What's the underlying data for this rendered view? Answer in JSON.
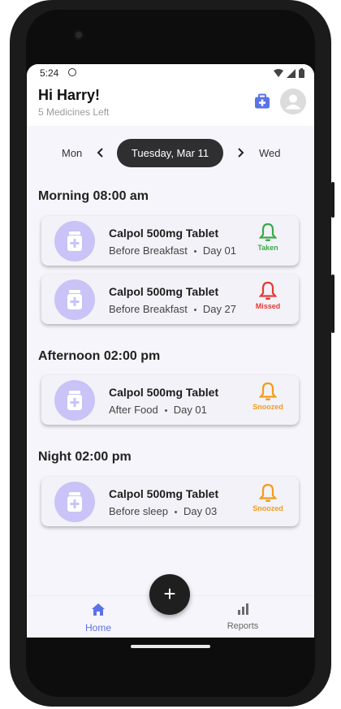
{
  "status_bar": {
    "time": "5:24"
  },
  "header": {
    "greeting": "Hi Harry!",
    "subtitle": "5 Medicines Left"
  },
  "date_strip": {
    "prev_day": "Mon",
    "selected_date": "Tuesday, Mar 11",
    "next_day": "Wed"
  },
  "sections": [
    {
      "title": "Morning 08:00 am",
      "cards": [
        {
          "name": "Calpol 500mg Tablet",
          "timing": "Before Breakfast",
          "day": "Day 01",
          "status": "Taken",
          "status_color": "#3aaa4a"
        },
        {
          "name": "Calpol 500mg Tablet",
          "timing": "Before Breakfast",
          "day": "Day 27",
          "status": "Missed",
          "status_color": "#e53935"
        }
      ]
    },
    {
      "title": "Afternoon 02:00 pm",
      "cards": [
        {
          "name": "Calpol 500mg Tablet",
          "timing": "After Food",
          "day": "Day 01",
          "status": "Snoozed",
          "status_color": "#f59b1a"
        }
      ]
    },
    {
      "title": "Night 02:00 pm",
      "cards": [
        {
          "name": "Calpol 500mg Tablet",
          "timing": "Before sleep",
          "day": "Day 03",
          "status": "Snoozed",
          "status_color": "#f59b1a"
        }
      ]
    }
  ],
  "fab": {
    "label": "+"
  },
  "nav": [
    {
      "label": "Home",
      "icon": "home-icon",
      "active": true
    },
    {
      "label": "Reports",
      "icon": "bar-chart-icon",
      "active": false
    }
  ],
  "colors": {
    "accent": "#5b73e8",
    "avatar_bg": "#dcdcdc",
    "pill_bg": "#c9c3f7"
  }
}
